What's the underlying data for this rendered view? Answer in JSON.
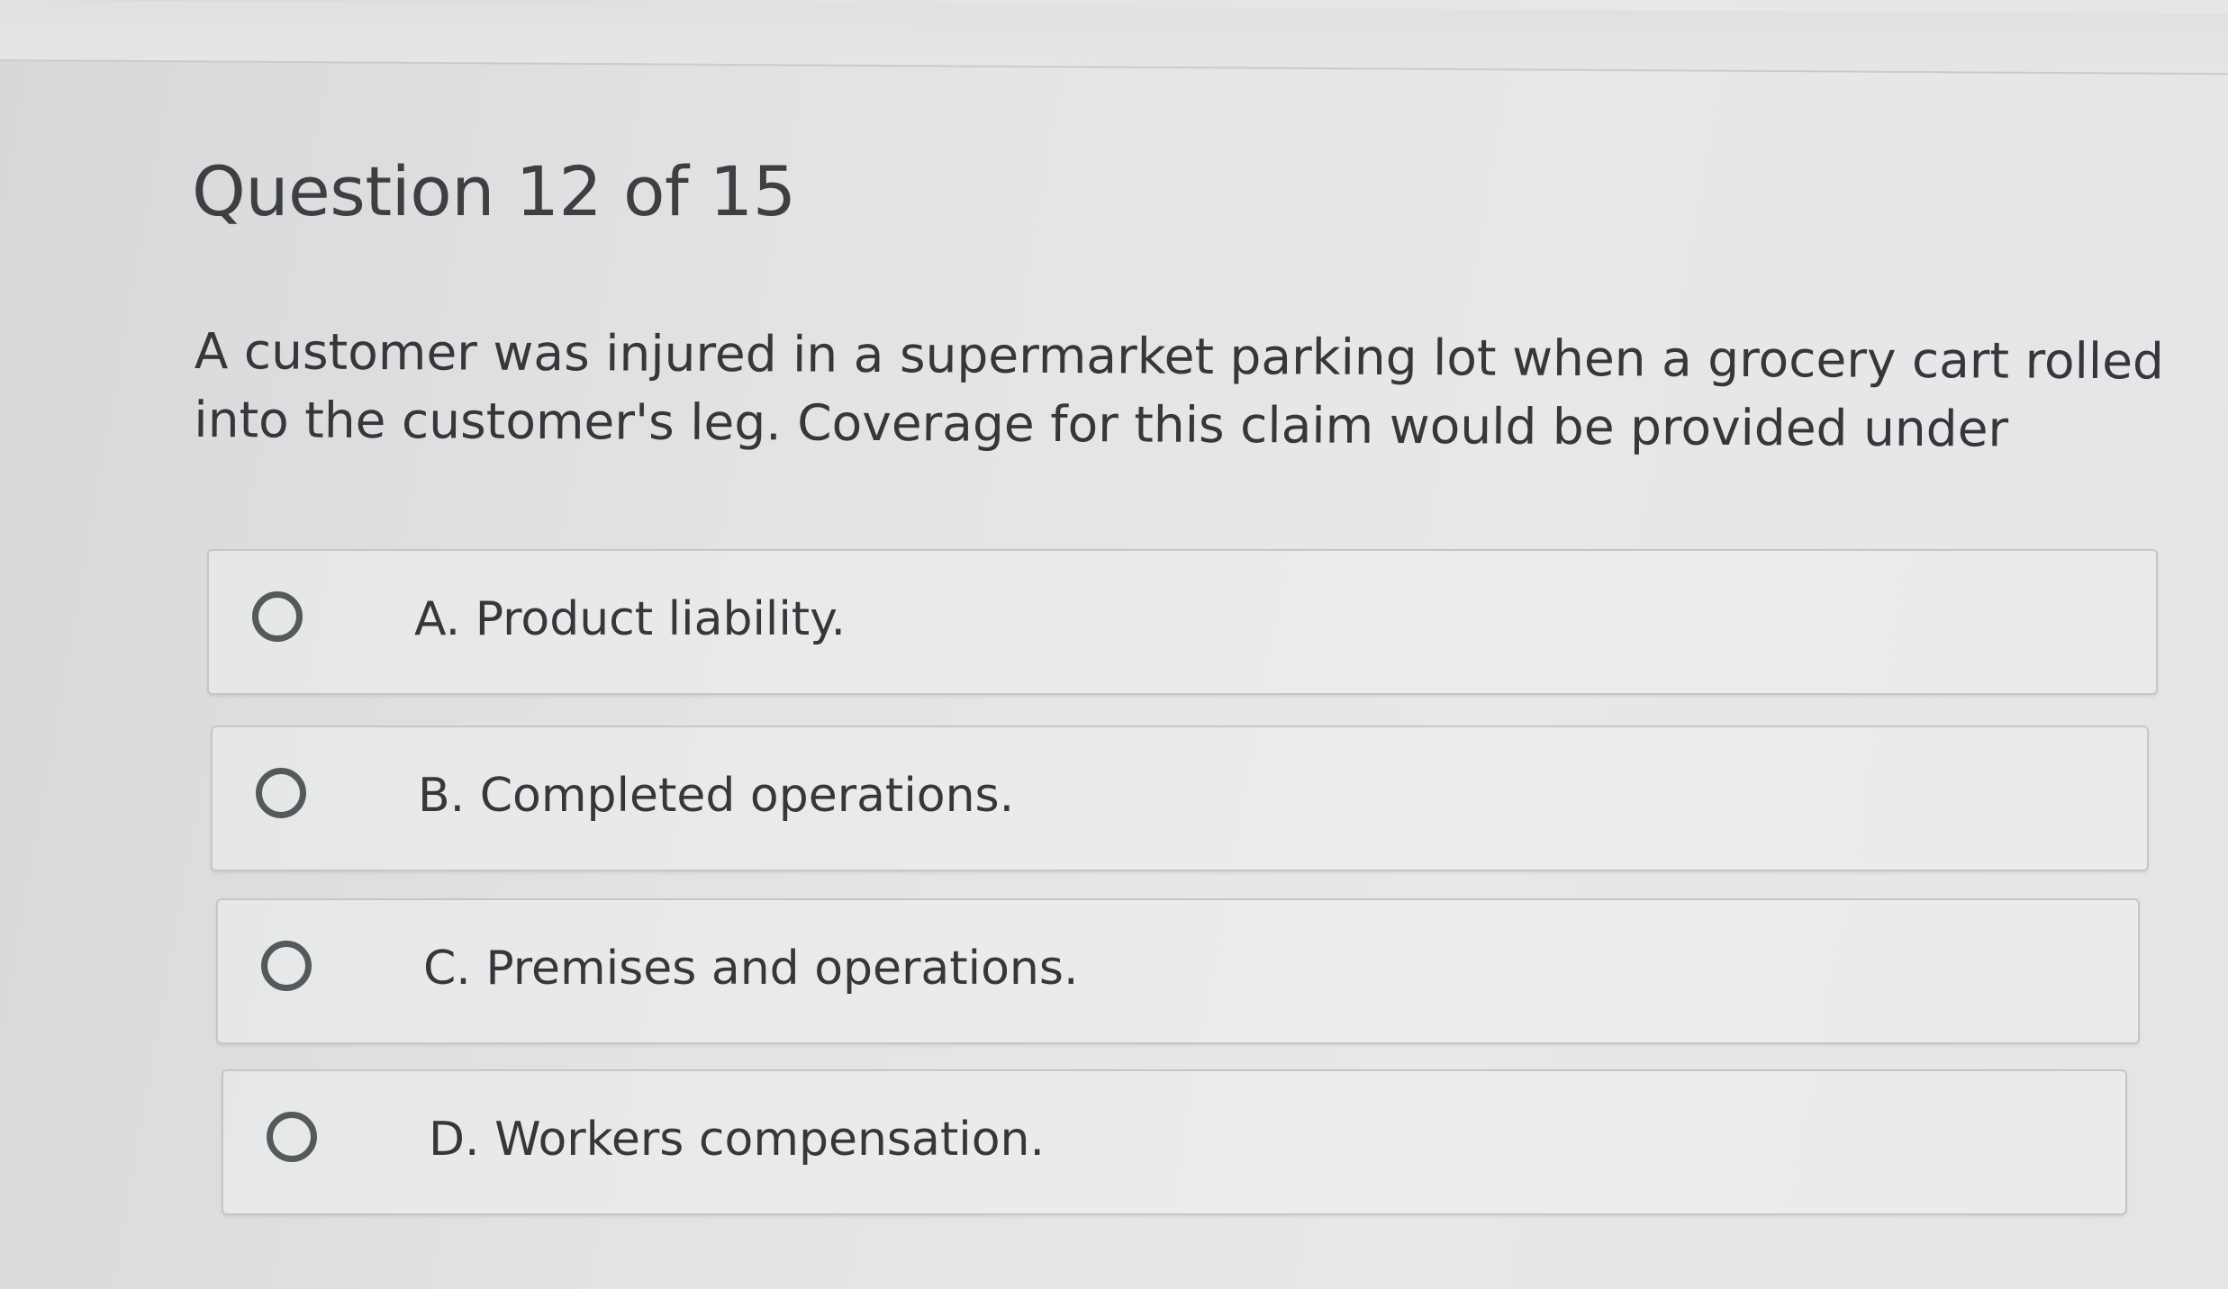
{
  "question": {
    "title": "Question 12 of 15",
    "text_line1": "A customer was injured in a supermarket parking lot when a grocery cart rolled",
    "text_line2": "into the customer's leg. Coverage for this claim would be provided under"
  },
  "choices": [
    {
      "label": "A. Product liability.",
      "selected": false
    },
    {
      "label": "B. Completed operations.",
      "selected": false
    },
    {
      "label": "C. Premises and operations.",
      "selected": false
    },
    {
      "label": "D. Workers compensation.",
      "selected": false
    }
  ],
  "colors": {
    "text": "#35373a",
    "radio_border": "#56595c",
    "card_border": "#c4c6c8"
  }
}
